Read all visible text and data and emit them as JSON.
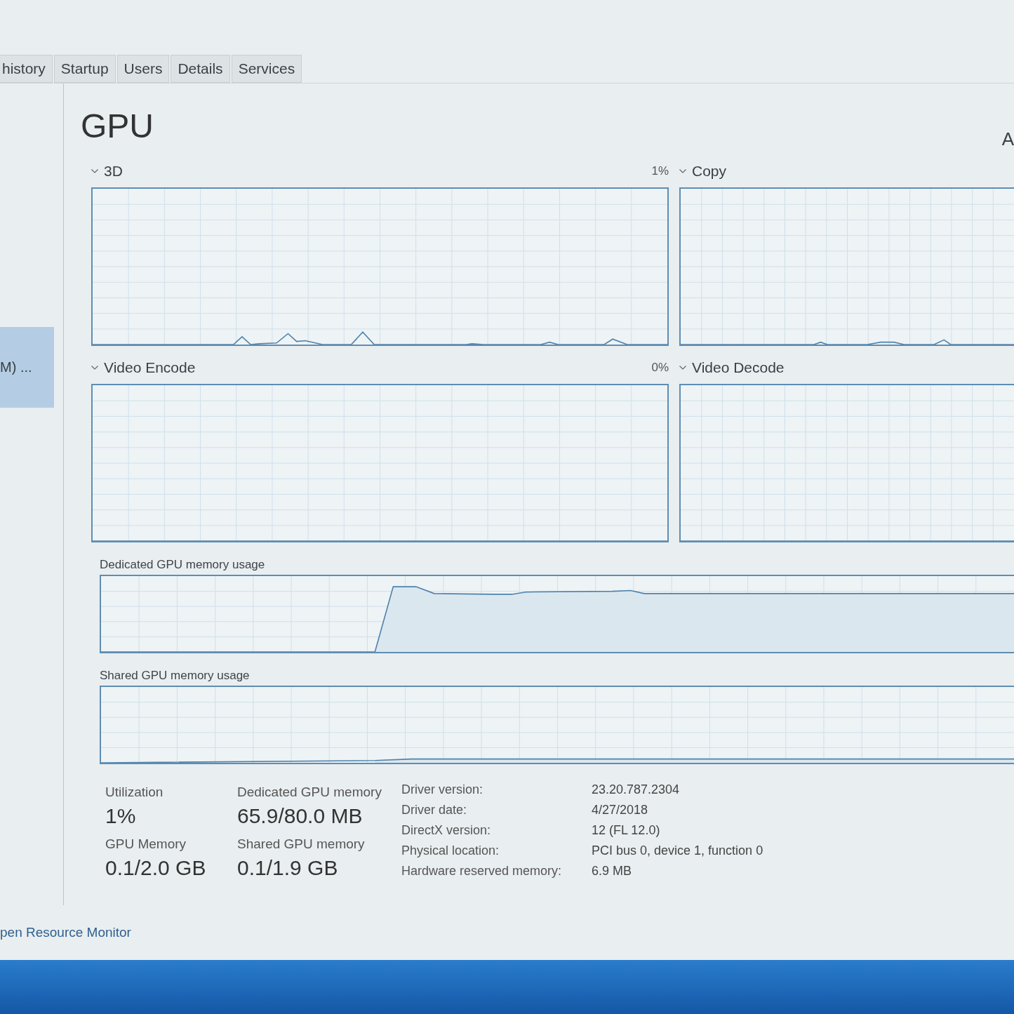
{
  "tabs": [
    {
      "label": "history",
      "selected": false
    },
    {
      "label": "Startup",
      "selected": false
    },
    {
      "label": "Users",
      "selected": false
    },
    {
      "label": "Details",
      "selected": false
    },
    {
      "label": "Services",
      "selected": false
    }
  ],
  "sidebar": {
    "items": [
      {
        "label": "M) ...",
        "selected": true
      }
    ]
  },
  "header": {
    "title": "GPU",
    "device_name": "A"
  },
  "engines": [
    {
      "label": "3D",
      "reading": "1%"
    },
    {
      "label": "Copy"
    },
    {
      "label": "Video Encode",
      "reading": "0%"
    },
    {
      "label": "Video Decode"
    }
  ],
  "memory_graphs": [
    {
      "label": "Dedicated GPU memory usage"
    },
    {
      "label": "Shared GPU memory usage"
    }
  ],
  "stats": [
    {
      "label": "Utilization",
      "value": "1%"
    },
    {
      "label": "Dedicated GPU memory",
      "value": "65.9/80.0 MB"
    },
    {
      "label": "GPU Memory",
      "value": "0.1/2.0 GB"
    },
    {
      "label": "Shared GPU memory",
      "value": "0.1/1.9 GB"
    }
  ],
  "details": [
    {
      "label": "Driver version:",
      "value": "23.20.787.2304"
    },
    {
      "label": "Driver date:",
      "value": "4/27/2018"
    },
    {
      "label": "DirectX version:",
      "value": "12 (FL 12.0)"
    },
    {
      "label": "Physical location:",
      "value": "PCI bus 0, device 1, function 0"
    },
    {
      "label": "Hardware reserved memory:",
      "value": "6.9 MB"
    }
  ],
  "footer": {
    "link": "pen Resource Monitor"
  }
}
